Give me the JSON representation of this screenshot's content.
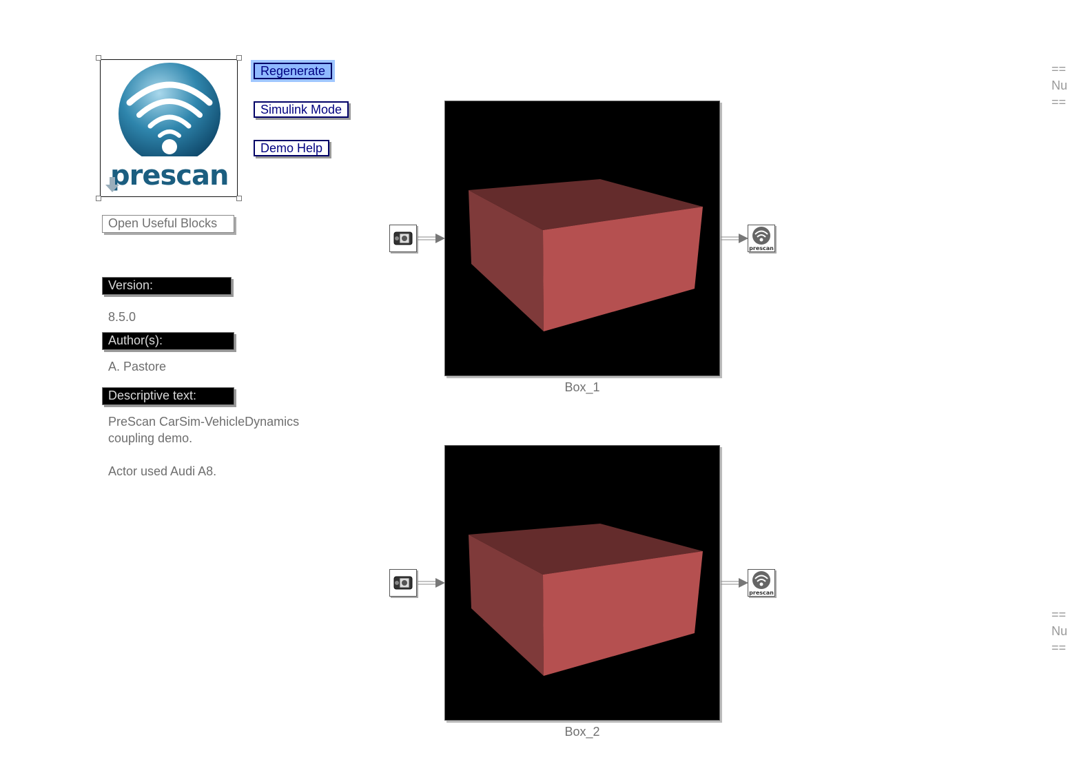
{
  "logo": {
    "brand_text": "prescan"
  },
  "buttons": {
    "regenerate": "Regenerate",
    "simulink_mode": "Simulink Mode",
    "demo_help": "Demo Help",
    "open_useful_blocks": "Open Useful Blocks"
  },
  "info": {
    "version_header": "Version:",
    "version_value": "8.5.0",
    "author_header": "Author(s):",
    "author_value": "A. Pastore",
    "desc_header": "Descriptive text:",
    "desc_line1": "PreScan CarSim-VehicleDynamics",
    "desc_line2": "coupling demo.",
    "desc_line3": "Actor used Audi A8."
  },
  "views": [
    {
      "label": "Box_1"
    },
    {
      "label": "Box_2"
    }
  ],
  "output_icon_text": "prescan",
  "right_edge": {
    "top": [
      "==",
      "Nu",
      "=="
    ],
    "bottom": [
      "==",
      "Nu",
      "=="
    ]
  },
  "colors": {
    "button_border": "#000066",
    "button_selected": "#8fb9ff",
    "box_front": "#b55050",
    "box_side": "#7f3a3a",
    "box_top": "#642c2c",
    "logo_blue": "#1b5e80"
  }
}
